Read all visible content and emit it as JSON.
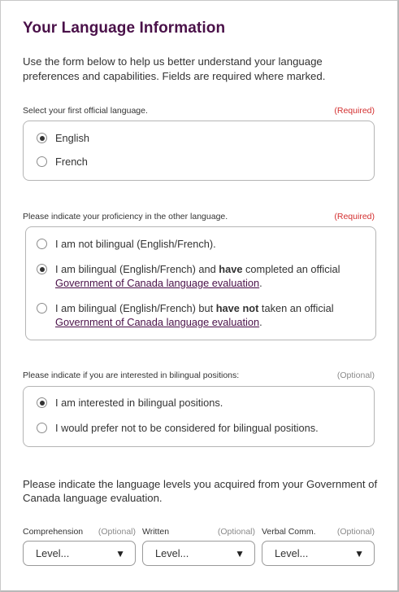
{
  "title": "Your Language Information",
  "intro": "Use the form below to help us better understand your language preferences and capabilities. Fields are required where marked.",
  "first_language": {
    "label": "Select your first official language.",
    "status": "(Required)",
    "options": [
      {
        "label": "English",
        "checked": true
      },
      {
        "label": "French",
        "checked": false
      }
    ]
  },
  "proficiency": {
    "label": "Please indicate your proficiency in the other language.",
    "status": "(Required)",
    "option1": "I am not bilingual (English/French).",
    "option2_pre": "I am bilingual (English/French) and ",
    "option2_bold": "have",
    "option2_post": " completed an official",
    "option2_link": "Government of Canada language evaluation",
    "option2_end": ".",
    "option3_pre": "I am bilingual (English/French) but ",
    "option3_bold": "have not",
    "option3_post": " taken an official",
    "option3_link": "Government of Canada language evaluation",
    "option3_end": ".",
    "selected": 2
  },
  "bilingual_interest": {
    "label": "Please indicate if you are interested in bilingual positions:",
    "status": "(Optional)",
    "option1": "I am interested in bilingual positions.",
    "option2": "I would prefer not to be considered for bilingual positions.",
    "selected": 1
  },
  "levels": {
    "text": "Please indicate the language levels you acquired from your Government of Canada language evaluation.",
    "fields": [
      {
        "label": "Comprehension",
        "status": "(Optional)",
        "value": "Level..."
      },
      {
        "label": "Written",
        "status": "(Optional)",
        "value": "Level..."
      },
      {
        "label": "Verbal Comm.",
        "status": "(Optional)",
        "value": "Level..."
      }
    ]
  },
  "icons": {
    "caret": "▼"
  }
}
